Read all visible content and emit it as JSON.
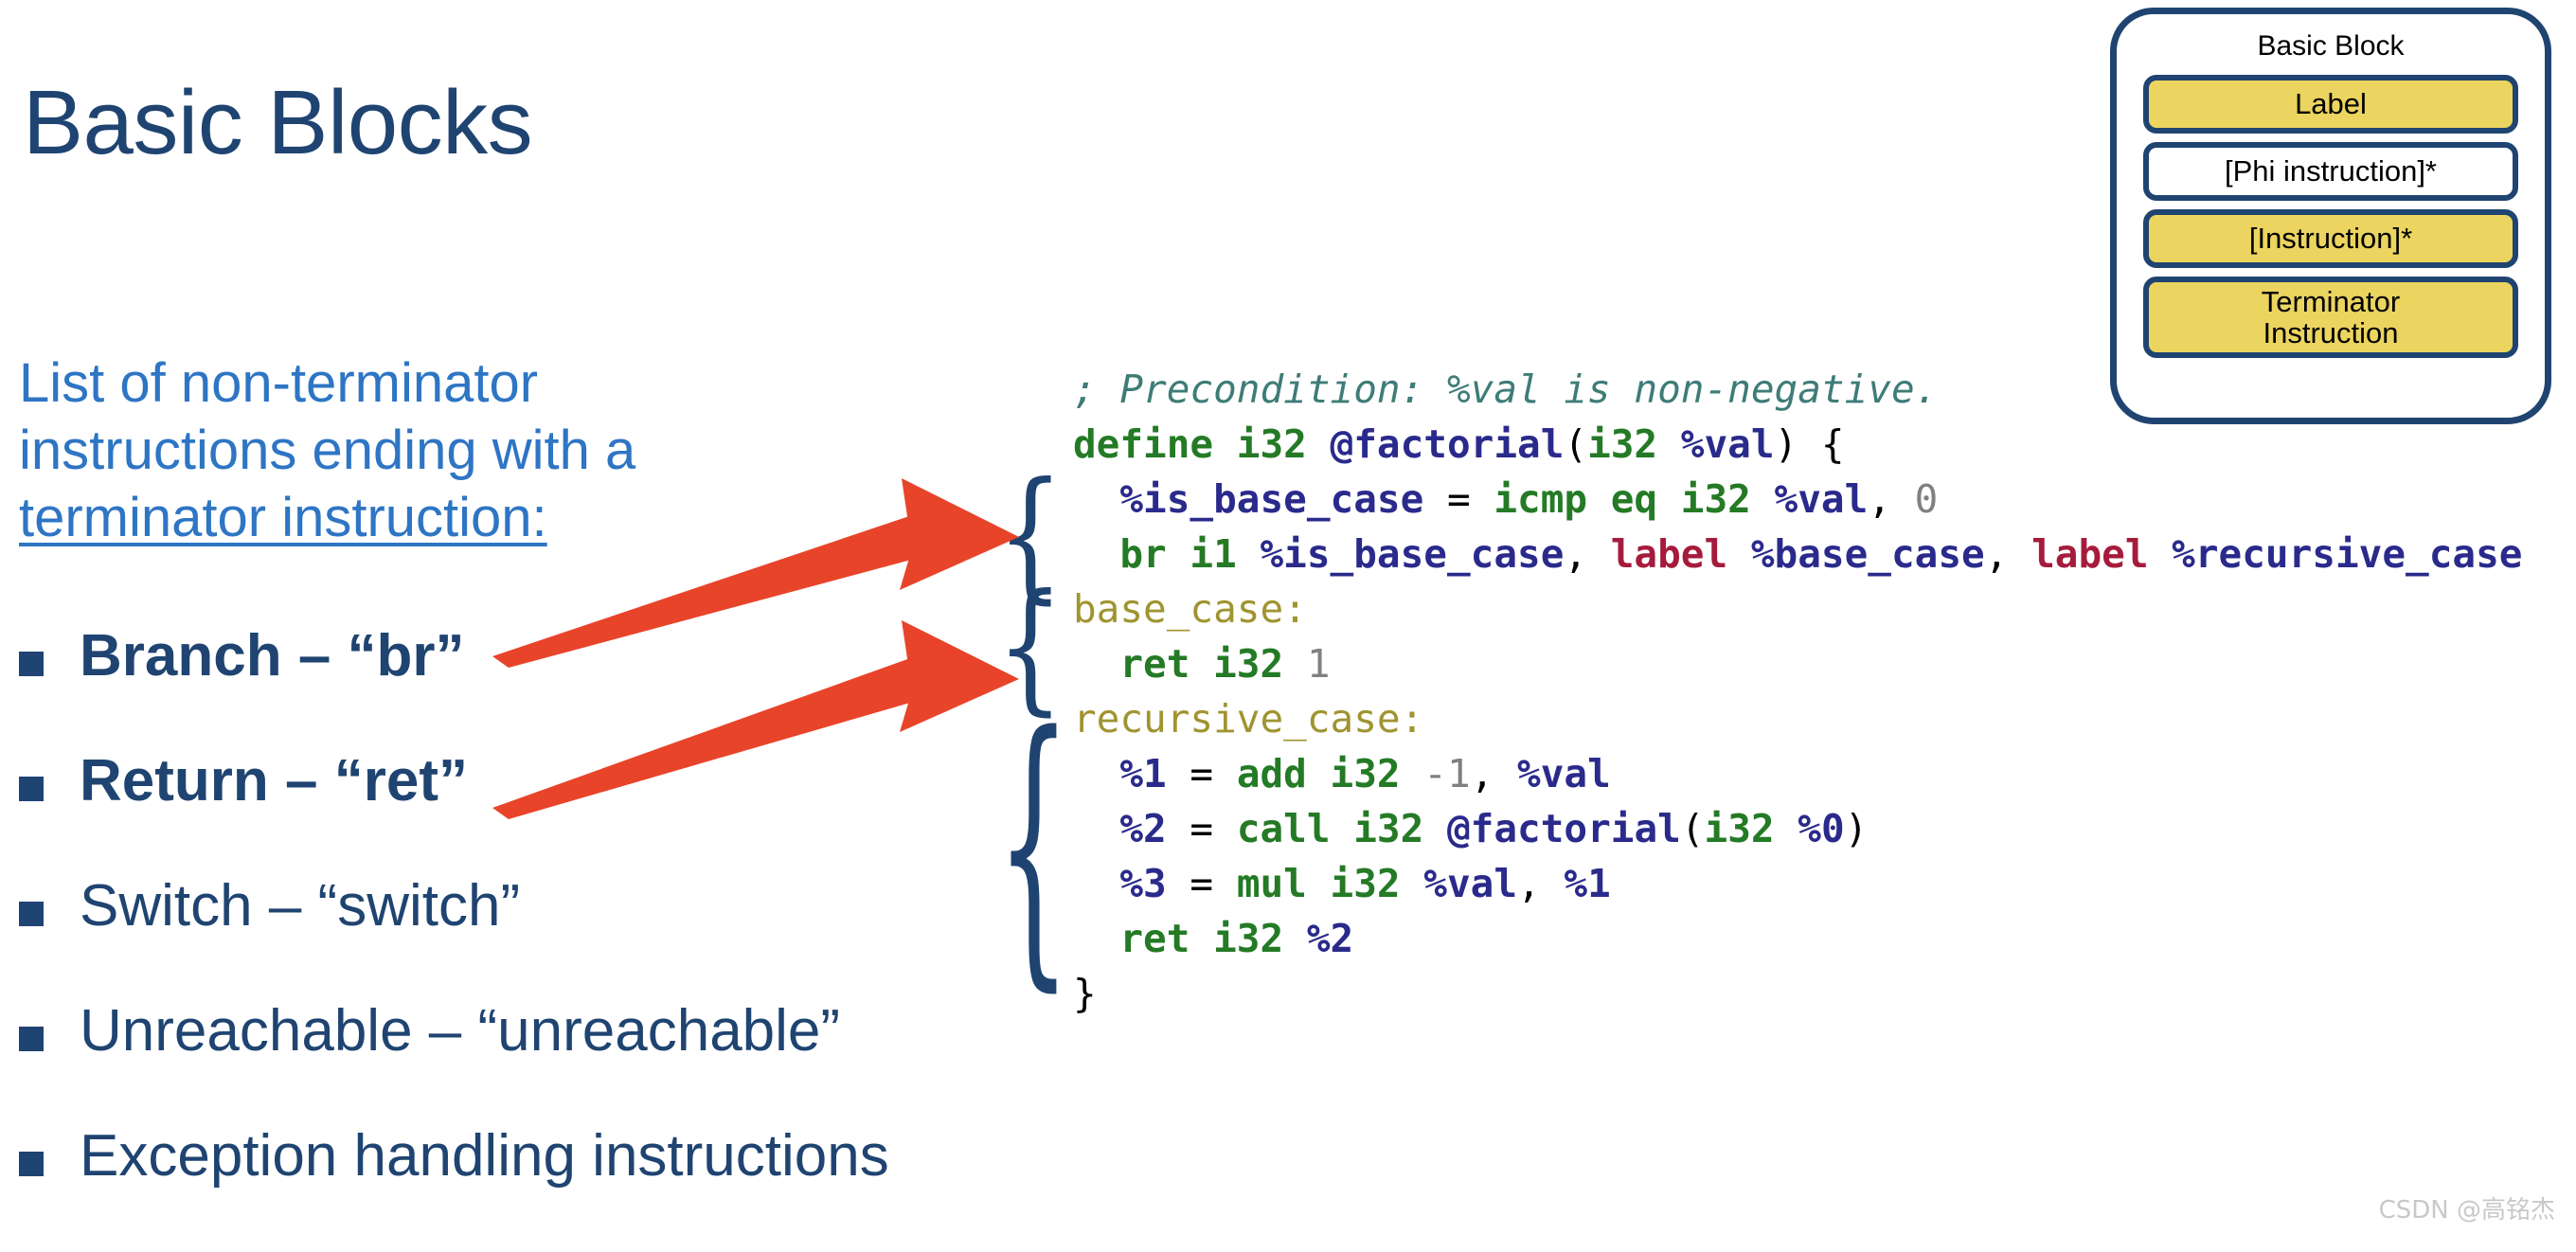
{
  "page": {
    "title": "Basic Blocks",
    "background_color": "#ffffff",
    "navy": "#1F4471",
    "light_blue": "#2E75C4",
    "arrow_color": "#E8442A",
    "yellow": "#EBD45F"
  },
  "lead": {
    "line1": "List of non-terminator",
    "line2": "instructions ending with a",
    "line3_underlined": "terminator instruction:"
  },
  "bullets": [
    {
      "label": "Branch – “br”",
      "bold": true
    },
    {
      "label": "Return – “ret”",
      "bold": true
    },
    {
      "label": "Switch – “switch”",
      "bold": false
    },
    {
      "label": "Unreachable – “unreachable”",
      "bold": false
    },
    {
      "label": "Exception handling instructions",
      "bold": false
    }
  ],
  "code": {
    "language": "LLVM IR",
    "lines": [
      {
        "id": "line-comment",
        "tokens": [
          {
            "t": "; Precondition: %val is non-negative.",
            "c": "c-comment"
          }
        ]
      },
      {
        "id": "line-define",
        "tokens": [
          {
            "t": "define i32 ",
            "c": "c-kw"
          },
          {
            "t": "@factorial",
            "c": "c-var"
          },
          {
            "t": "(",
            "c": "c-plain"
          },
          {
            "t": "i32",
            "c": "c-kw"
          },
          {
            "t": " %val",
            "c": "c-var"
          },
          {
            "t": ") {",
            "c": "c-plain"
          }
        ]
      },
      {
        "id": "line-icmp",
        "tokens": [
          {
            "t": "  %is_base_case",
            "c": "c-var"
          },
          {
            "t": " = ",
            "c": "c-plain"
          },
          {
            "t": "icmp eq i32",
            "c": "c-kw"
          },
          {
            "t": " %val",
            "c": "c-var"
          },
          {
            "t": ", ",
            "c": "c-plain"
          },
          {
            "t": "0",
            "c": "c-num"
          }
        ]
      },
      {
        "id": "line-br",
        "tokens": [
          {
            "t": "  br i1",
            "c": "c-kw"
          },
          {
            "t": " %is_base_case",
            "c": "c-var"
          },
          {
            "t": ", ",
            "c": "c-plain"
          },
          {
            "t": "label",
            "c": "c-label"
          },
          {
            "t": " %base_case",
            "c": "c-var"
          },
          {
            "t": ", ",
            "c": "c-plain"
          },
          {
            "t": "label",
            "c": "c-label"
          },
          {
            "t": " %recursive_case",
            "c": "c-var"
          }
        ]
      },
      {
        "id": "line-base-label",
        "tokens": [
          {
            "t": "base_case:",
            "c": "c-blk"
          }
        ]
      },
      {
        "id": "line-ret1",
        "tokens": [
          {
            "t": "  ret i32",
            "c": "c-kw"
          },
          {
            "t": " ",
            "c": "c-plain"
          },
          {
            "t": "1",
            "c": "c-num"
          }
        ]
      },
      {
        "id": "line-recursive-label",
        "tokens": [
          {
            "t": "recursive_case:",
            "c": "c-blk"
          }
        ]
      },
      {
        "id": "line-add",
        "tokens": [
          {
            "t": "  %1",
            "c": "c-var"
          },
          {
            "t": " = ",
            "c": "c-plain"
          },
          {
            "t": "add i32",
            "c": "c-kw"
          },
          {
            "t": " ",
            "c": "c-plain"
          },
          {
            "t": "-1",
            "c": "c-num"
          },
          {
            "t": ", ",
            "c": "c-plain"
          },
          {
            "t": "%val",
            "c": "c-var"
          }
        ]
      },
      {
        "id": "line-call",
        "tokens": [
          {
            "t": "  %2",
            "c": "c-var"
          },
          {
            "t": " = ",
            "c": "c-plain"
          },
          {
            "t": "call i32 ",
            "c": "c-kw"
          },
          {
            "t": "@factorial",
            "c": "c-var"
          },
          {
            "t": "(",
            "c": "c-plain"
          },
          {
            "t": "i32",
            "c": "c-kw"
          },
          {
            "t": " %0",
            "c": "c-var"
          },
          {
            "t": ")",
            "c": "c-plain"
          }
        ]
      },
      {
        "id": "line-mul",
        "tokens": [
          {
            "t": "  %3",
            "c": "c-var"
          },
          {
            "t": " = ",
            "c": "c-plain"
          },
          {
            "t": "mul i32",
            "c": "c-kw"
          },
          {
            "t": " %val",
            "c": "c-var"
          },
          {
            "t": ", ",
            "c": "c-plain"
          },
          {
            "t": "%1",
            "c": "c-var"
          }
        ]
      },
      {
        "id": "line-ret2",
        "tokens": [
          {
            "t": "  ret i32",
            "c": "c-kw"
          },
          {
            "t": " %2",
            "c": "c-var"
          }
        ]
      },
      {
        "id": "line-close",
        "tokens": [
          {
            "t": "}",
            "c": "c-plain"
          }
        ]
      }
    ]
  },
  "braces": {
    "glyph": "{",
    "groups": [
      {
        "name": "entry-block-brace"
      },
      {
        "name": "base-case-block-brace"
      },
      {
        "name": "recursive-case-block-brace"
      }
    ]
  },
  "diagram": {
    "title": "Basic Block",
    "rows": [
      {
        "label": "Label",
        "fill": "yellow",
        "height": "h1"
      },
      {
        "label": "[Phi instruction]*",
        "fill": "white",
        "height": "h1"
      },
      {
        "label": "[Instruction]*",
        "fill": "yellow",
        "height": "h1"
      },
      {
        "label": "Terminator\nInstruction",
        "fill": "yellow",
        "height": "h2"
      }
    ]
  },
  "watermark": {
    "text": "CSDN @高铭杰"
  }
}
